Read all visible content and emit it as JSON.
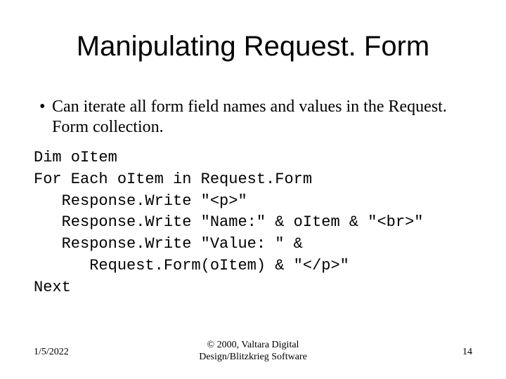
{
  "title": "Manipulating Request. Form",
  "bullet": "Can iterate all form field names and values in the Request. Form collection.",
  "code": {
    "l1": "Dim oItem",
    "l2": "For Each oItem in Request.Form",
    "l3": "   Response.Write \"<p>\"",
    "l4": "   Response.Write \"Name:\" & oItem & \"<br>\"",
    "l5": "   Response.Write \"Value: \" &",
    "l6": "      Request.Form(oItem) & \"</p>\"",
    "l7": "Next"
  },
  "footer": {
    "date": "1/5/2022",
    "copyright_line1": "© 2000, Valtara Digital",
    "copyright_line2": "Design/Blitzkrieg Software",
    "page": "14"
  }
}
